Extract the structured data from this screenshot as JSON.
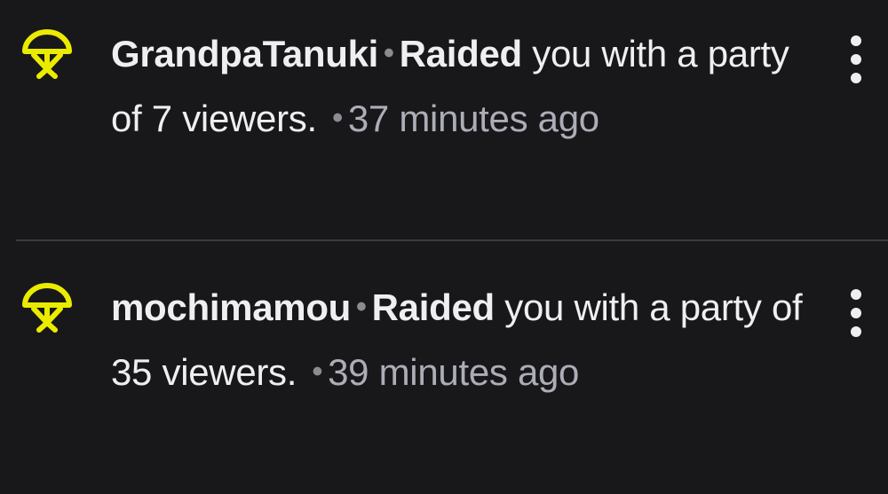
{
  "feed": {
    "events": [
      {
        "username": "GrandpaTanuki",
        "separator": "•",
        "action": "Raided",
        "detail_pre": " you with a party of ",
        "viewer_count": "7",
        "detail_post": " viewers.",
        "time_separator": "•",
        "time_ago": "37 minutes ago",
        "icon": "raid-icon",
        "menu_icon": "more-vertical-icon"
      },
      {
        "username": "mochimamou",
        "separator": "•",
        "action": "Raided",
        "detail_pre": " you with a party of ",
        "viewer_count": "35",
        "detail_post": " viewers.",
        "time_separator": "•",
        "time_ago": "39 minutes ago",
        "icon": "raid-icon",
        "menu_icon": "more-vertical-icon"
      }
    ]
  },
  "colors": {
    "background": "#18181b",
    "text_primary": "#efeff1",
    "text_muted": "#adadb8",
    "icon_accent": "#ebeb00",
    "divider": "#3a3a3f"
  }
}
